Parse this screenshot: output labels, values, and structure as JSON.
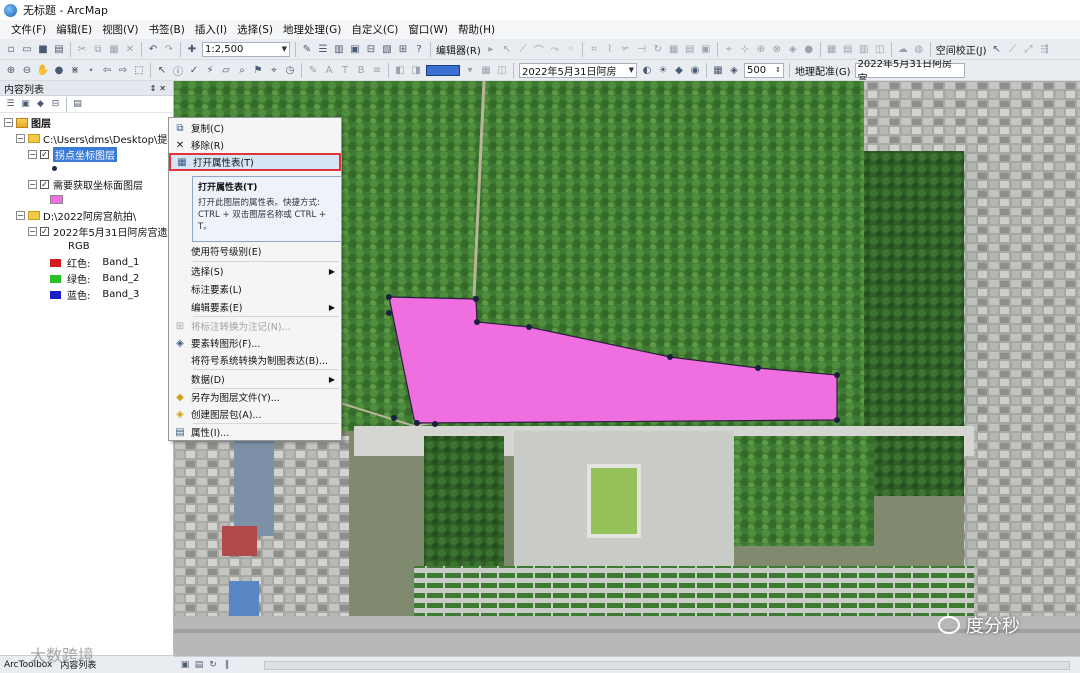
{
  "window": {
    "title": "无标题 - ArcMap"
  },
  "menubar": {
    "items": [
      "文件(F)",
      "编辑(E)",
      "视图(V)",
      "书签(B)",
      "插入(I)",
      "选择(S)",
      "地理处理(G)",
      "自定义(C)",
      "窗口(W)",
      "帮助(H)"
    ]
  },
  "toolbar1": {
    "scale": "1:2,500",
    "editor_label": "编辑器(R)",
    "spatial_adjust_label": "空间校正(J)"
  },
  "toolbar2": {
    "layer_combo": "2022年5月31日阿房",
    "pixel_value": "500",
    "georef_label": "地理配准(G)",
    "georef_layer": "2022年5月31日阿房宫"
  },
  "toc": {
    "title": "内容列表",
    "root_label": "图层",
    "group1_path": "C:\\Users\\dms\\Desktop\\提取",
    "layer1_name": "拐点坐标图层",
    "layer2_name": "需要获取坐标面图层",
    "group2_path": "D:\\2022阿房宫航拍\\",
    "raster_name": "2022年5月31日阿房宫遗",
    "rgb_label": "RGB",
    "bands": [
      {
        "label": "红色:",
        "name": "Band_1",
        "color": "#d01c1c"
      },
      {
        "label": "绿色:",
        "name": "Band_2",
        "color": "#27c127"
      },
      {
        "label": "蓝色:",
        "name": "Band_3",
        "color": "#1c1cc8"
      }
    ],
    "bottom_tabs": [
      "ArcToolbox",
      "内容列表"
    ]
  },
  "context_menu": {
    "items": [
      {
        "label": "复制(C)",
        "icon": "copy-icon"
      },
      {
        "label": "移除(R)",
        "icon": "remove-icon"
      },
      {
        "label": "打开属性表(T)",
        "icon": "table-icon"
      },
      {
        "label": "使用符号级别(E)"
      },
      {
        "label": "选择(S)"
      },
      {
        "label": "标注要素(L)"
      },
      {
        "label": "编辑要素(E)"
      },
      {
        "label": "将标注转换为注记(N)..."
      },
      {
        "label": "要素转图形(F)..."
      },
      {
        "label": "将符号系统转换为制图表达(B)..."
      },
      {
        "label": "数据(D)"
      },
      {
        "label": "另存为图层文件(Y)..."
      },
      {
        "label": "创建图层包(A)..."
      },
      {
        "label": "属性(I)..."
      }
    ]
  },
  "tooltip": {
    "title": "打开属性表(T)",
    "body": "打开此图层的属性表。快捷方式: CTRL + 双击图层名称或 CTRL + T。"
  },
  "watermarks": {
    "wechat": "度分秒",
    "bottom": "大数跨境"
  },
  "colors": {
    "polygon_fill": "#f06fe0",
    "highlight_border": "#e0363a",
    "selection": "#3a7bd5"
  }
}
